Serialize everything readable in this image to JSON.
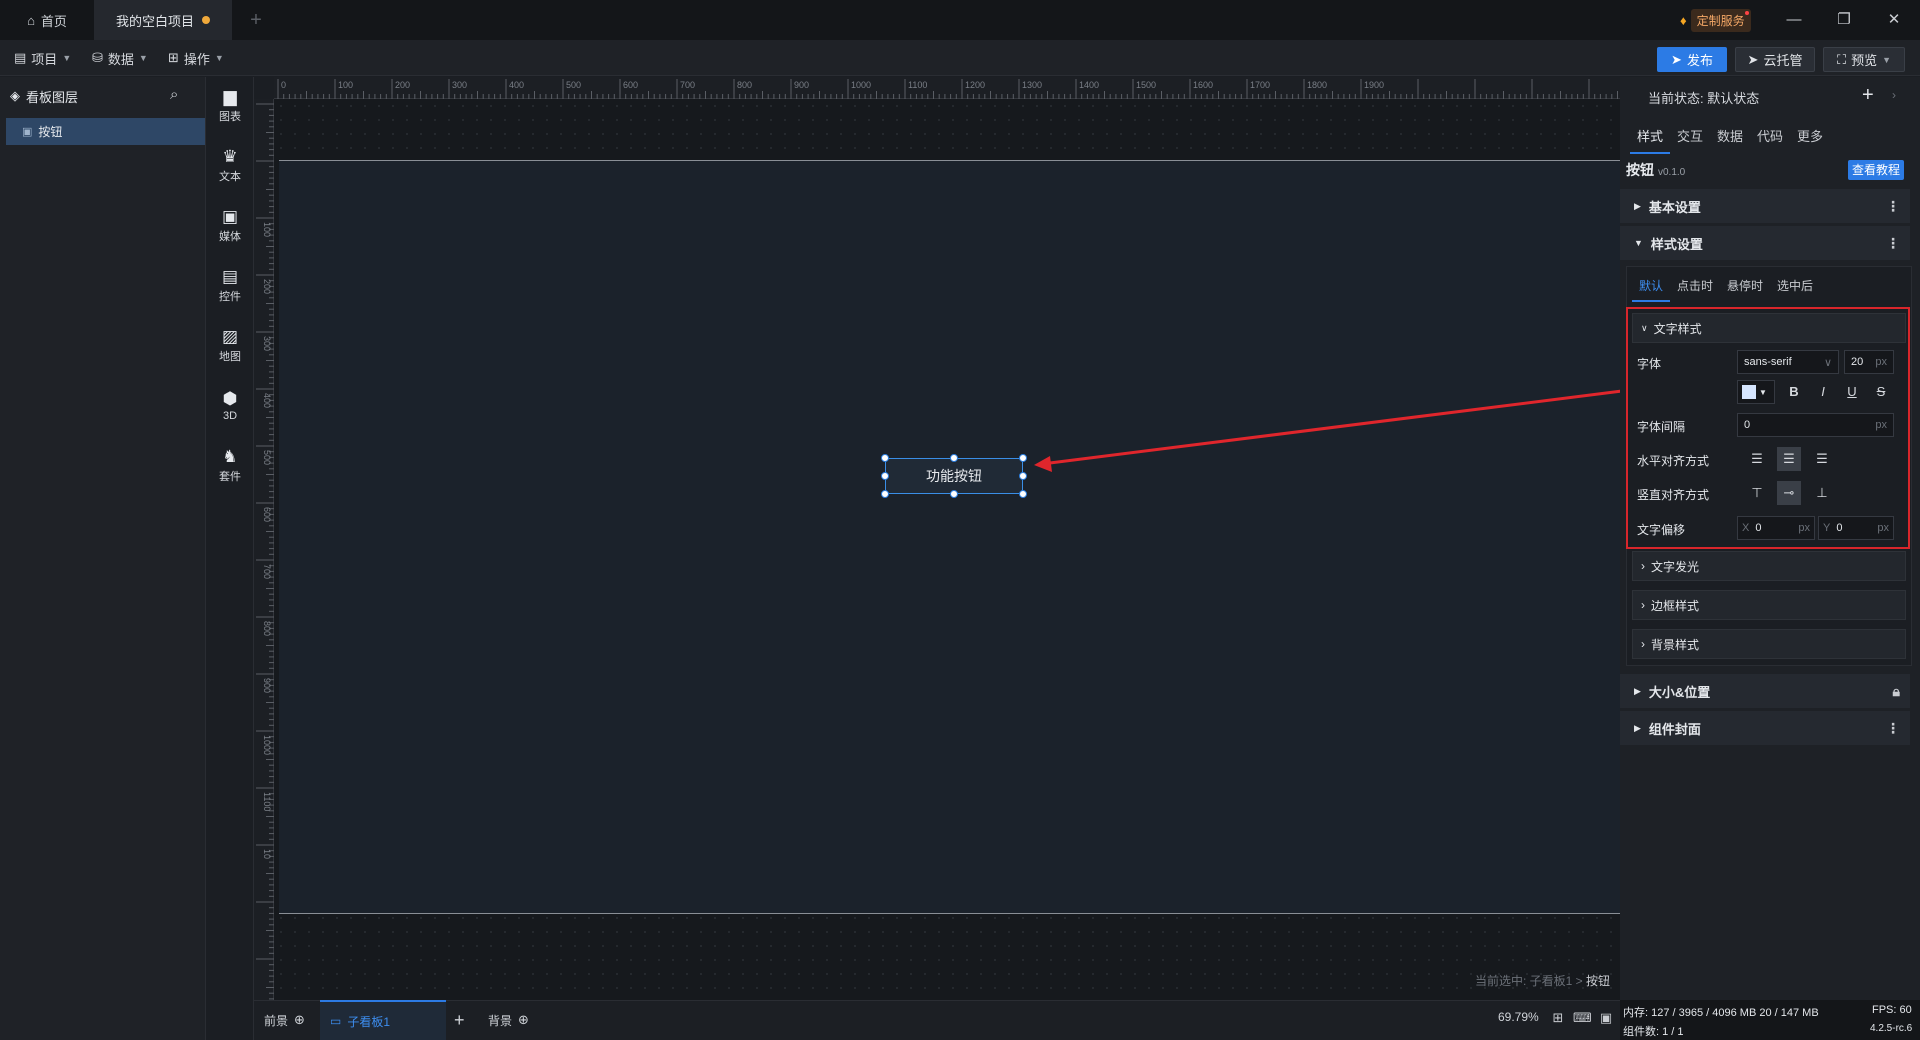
{
  "titlebar": {
    "home_tab": "首页",
    "project_tab": "我的空白项目",
    "custom_service": "定制服务"
  },
  "toolbar": {
    "menus": [
      "项目",
      "数据",
      "操作"
    ],
    "publish": "发布",
    "cloud_host": "云托管",
    "preview": "预览"
  },
  "layers": {
    "title": "看板图层",
    "items": [
      "按钮"
    ]
  },
  "component_bar": [
    "图表",
    "文本",
    "媒体",
    "控件",
    "地图",
    "3D",
    "套件"
  ],
  "rulers": {
    "top": [
      "0",
      "100",
      "200",
      "300",
      "400",
      "500",
      "600",
      "700",
      "800",
      "900",
      "1000",
      "1100",
      "1200",
      "1300",
      "1400",
      "1500",
      "1600",
      "1700",
      "1800",
      "1900"
    ],
    "left": [
      "100",
      "200",
      "300",
      "400",
      "500",
      "600",
      "700",
      "800",
      "900",
      "1000",
      "1100",
      "10"
    ]
  },
  "canvas": {
    "button_text": "功能按钮",
    "breadcrumb_prefix": "当前选中: 子看板1 > ",
    "breadcrumb_current": "按钮"
  },
  "bottombar": {
    "foreground": "前景",
    "active_board": "子看板1",
    "background": "背景",
    "zoom": "69.79%"
  },
  "status": {
    "memory": "内存: 127 / 3965 / 4096 MB 20 / 147 MB",
    "fps": "FPS: 60",
    "component_count": "组件数: 1 / 1",
    "version": "4.2.5-rc.6"
  },
  "properties": {
    "current_state": "当前状态: 默认状态",
    "tabs": [
      "样式",
      "交互",
      "数据",
      "代码",
      "更多"
    ],
    "component_name": "按钮",
    "component_version": "v0.1.0",
    "tutorial": "查看教程",
    "sections": {
      "basic": "基本设置",
      "style": "样式设置",
      "size_position": "大小&位置",
      "cover": "组件封面"
    },
    "state_tabs": [
      "默认",
      "点击时",
      "悬停时",
      "选中后"
    ],
    "text_style": {
      "title": "文字样式",
      "font_label": "字体",
      "font_value": "sans-serif",
      "font_size": "20",
      "unit": "px",
      "letter_spacing_label": "字体间隔",
      "letter_spacing_value": "0",
      "h_align_label": "水平对齐方式",
      "v_align_label": "竖直对齐方式",
      "offset_label": "文字偏移",
      "offset_x_label": "X",
      "offset_x": "0",
      "offset_y_label": "Y",
      "offset_y": "0",
      "color": "#d6e6ff"
    },
    "subsections": [
      "文字发光",
      "边框样式",
      "背景样式"
    ]
  },
  "colors": {
    "accent": "#2c7be5",
    "highlight": "#d9262b"
  }
}
